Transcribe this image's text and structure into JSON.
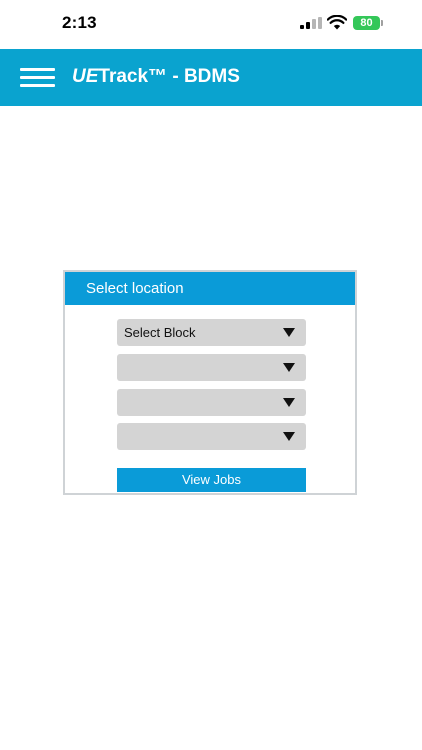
{
  "status_bar": {
    "time": "2:13",
    "battery": "80",
    "battery_color": "#34c759"
  },
  "header": {
    "title_italic": "UE",
    "title_rest": "Track™ - BDMS",
    "menu_icon": "hamburger-menu-icon",
    "background_color": "#0aa3cf"
  },
  "location_panel": {
    "title": "Select location",
    "header_color": "#0a9bd8",
    "dropdowns": [
      {
        "selected": "Select Block"
      },
      {
        "selected": ""
      },
      {
        "selected": ""
      },
      {
        "selected": ""
      }
    ],
    "view_jobs_label": "View Jobs"
  }
}
